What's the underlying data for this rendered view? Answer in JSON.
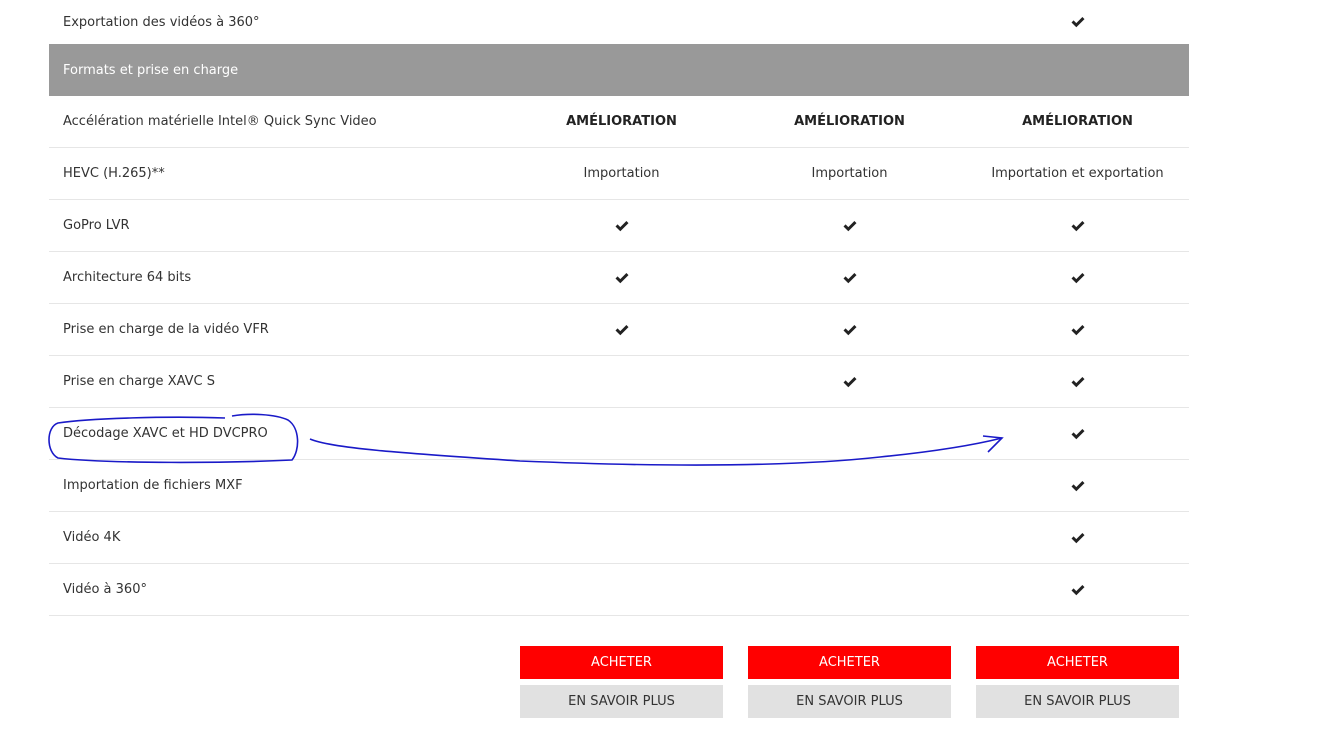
{
  "table": {
    "top_row": {
      "label": "Exportation des vidéos à 360°",
      "values": [
        "",
        "",
        "check"
      ]
    },
    "section_title": "Formats et prise en charge",
    "rows": [
      {
        "label": "Accélération matérielle Intel® Quick Sync Video",
        "values": [
          "AMÉLIORATION",
          "AMÉLIORATION",
          "AMÉLIORATION"
        ]
      },
      {
        "label": "HEVC (H.265)**",
        "values": [
          "Importation",
          "Importation",
          "Importation et exportation"
        ]
      },
      {
        "label": "GoPro LVR",
        "values": [
          "check",
          "check",
          "check"
        ]
      },
      {
        "label": "Architecture 64 bits",
        "values": [
          "check",
          "check",
          "check"
        ]
      },
      {
        "label": "Prise en charge de la vidéo VFR",
        "values": [
          "check",
          "check",
          "check"
        ]
      },
      {
        "label": "Prise en charge XAVC S",
        "values": [
          "",
          "check",
          "check"
        ]
      },
      {
        "label": "Décodage XAVC et HD DVCPRO",
        "values": [
          "",
          "",
          "check"
        ]
      },
      {
        "label": "Importation de fichiers MXF",
        "values": [
          "",
          "",
          "check"
        ]
      },
      {
        "label": "Vidéo 4K",
        "values": [
          "",
          "",
          "check"
        ]
      },
      {
        "label": "Vidéo à 360°",
        "values": [
          "",
          "",
          "check"
        ]
      }
    ]
  },
  "buttons": {
    "buy_label": "ACHETER",
    "learn_more_label": "EN SAVOIR PLUS"
  },
  "colors": {
    "section_bg": "#999999",
    "buy_bg": "#ff0000",
    "learn_more_bg": "#e1e1e1",
    "annotation": "#1a1ac8"
  },
  "icons": {
    "check": "checkmark-icon"
  }
}
